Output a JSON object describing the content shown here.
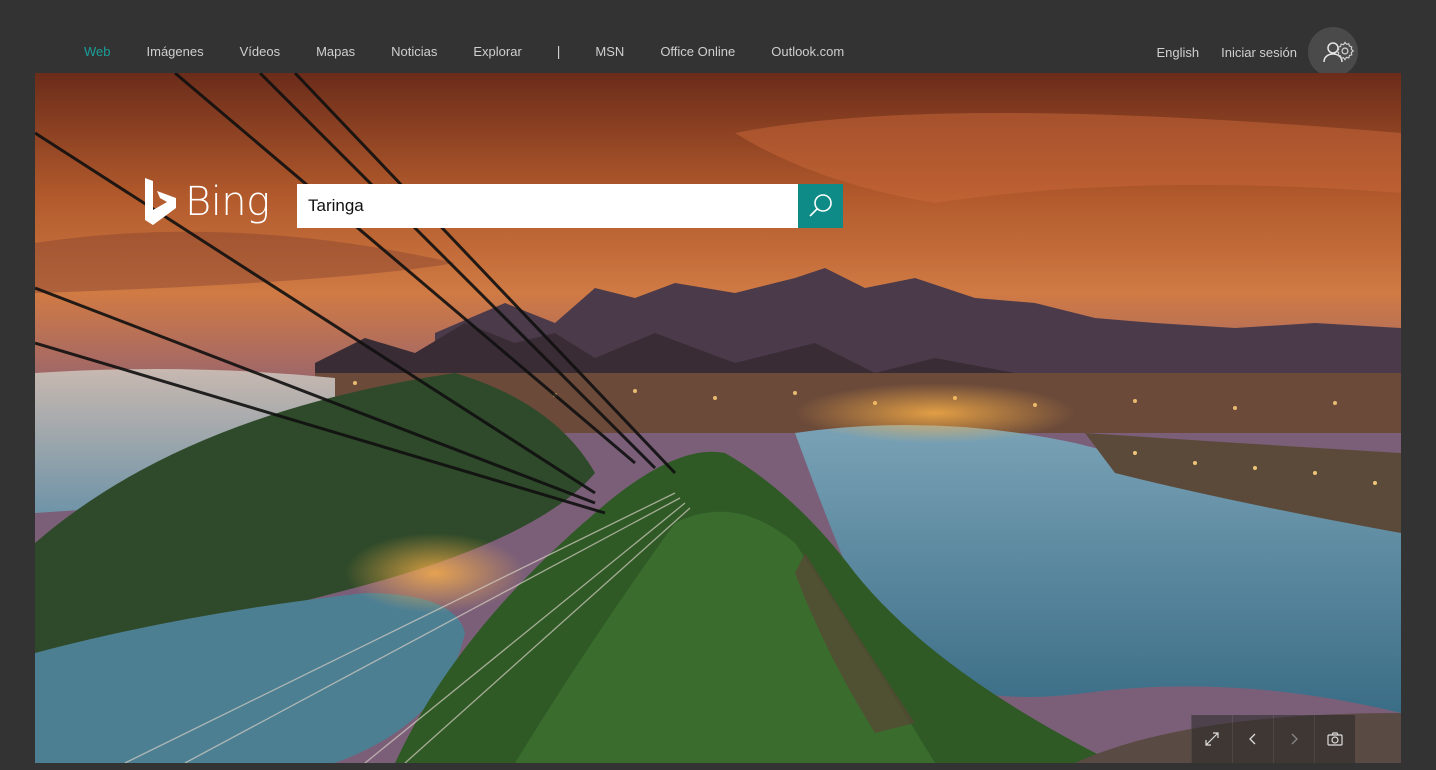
{
  "nav": {
    "links": [
      {
        "label": "Web",
        "active": true
      },
      {
        "label": "Imágenes"
      },
      {
        "label": "Vídeos"
      },
      {
        "label": "Mapas"
      },
      {
        "label": "Noticias"
      },
      {
        "label": "Explorar"
      }
    ],
    "separator": "|",
    "links2": [
      {
        "label": "MSN"
      },
      {
        "label": "Office Online"
      },
      {
        "label": "Outlook.com"
      }
    ],
    "language": "English",
    "signin": "Iniciar sesión",
    "avatar_icon": "user-icon",
    "settings_icon": "gear-icon"
  },
  "logo": {
    "text": "Bing",
    "icon": "bing-b-icon"
  },
  "search": {
    "value": "Taringa",
    "button_icon": "search-icon"
  },
  "controls": [
    {
      "icon": "expand-icon"
    },
    {
      "icon": "chevron-left-icon"
    },
    {
      "icon": "chevron-right-icon"
    },
    {
      "icon": "camera-icon"
    }
  ],
  "colors": {
    "accent": "#0e8a87",
    "active_link": "#1a9e9a",
    "background": "#333333"
  }
}
